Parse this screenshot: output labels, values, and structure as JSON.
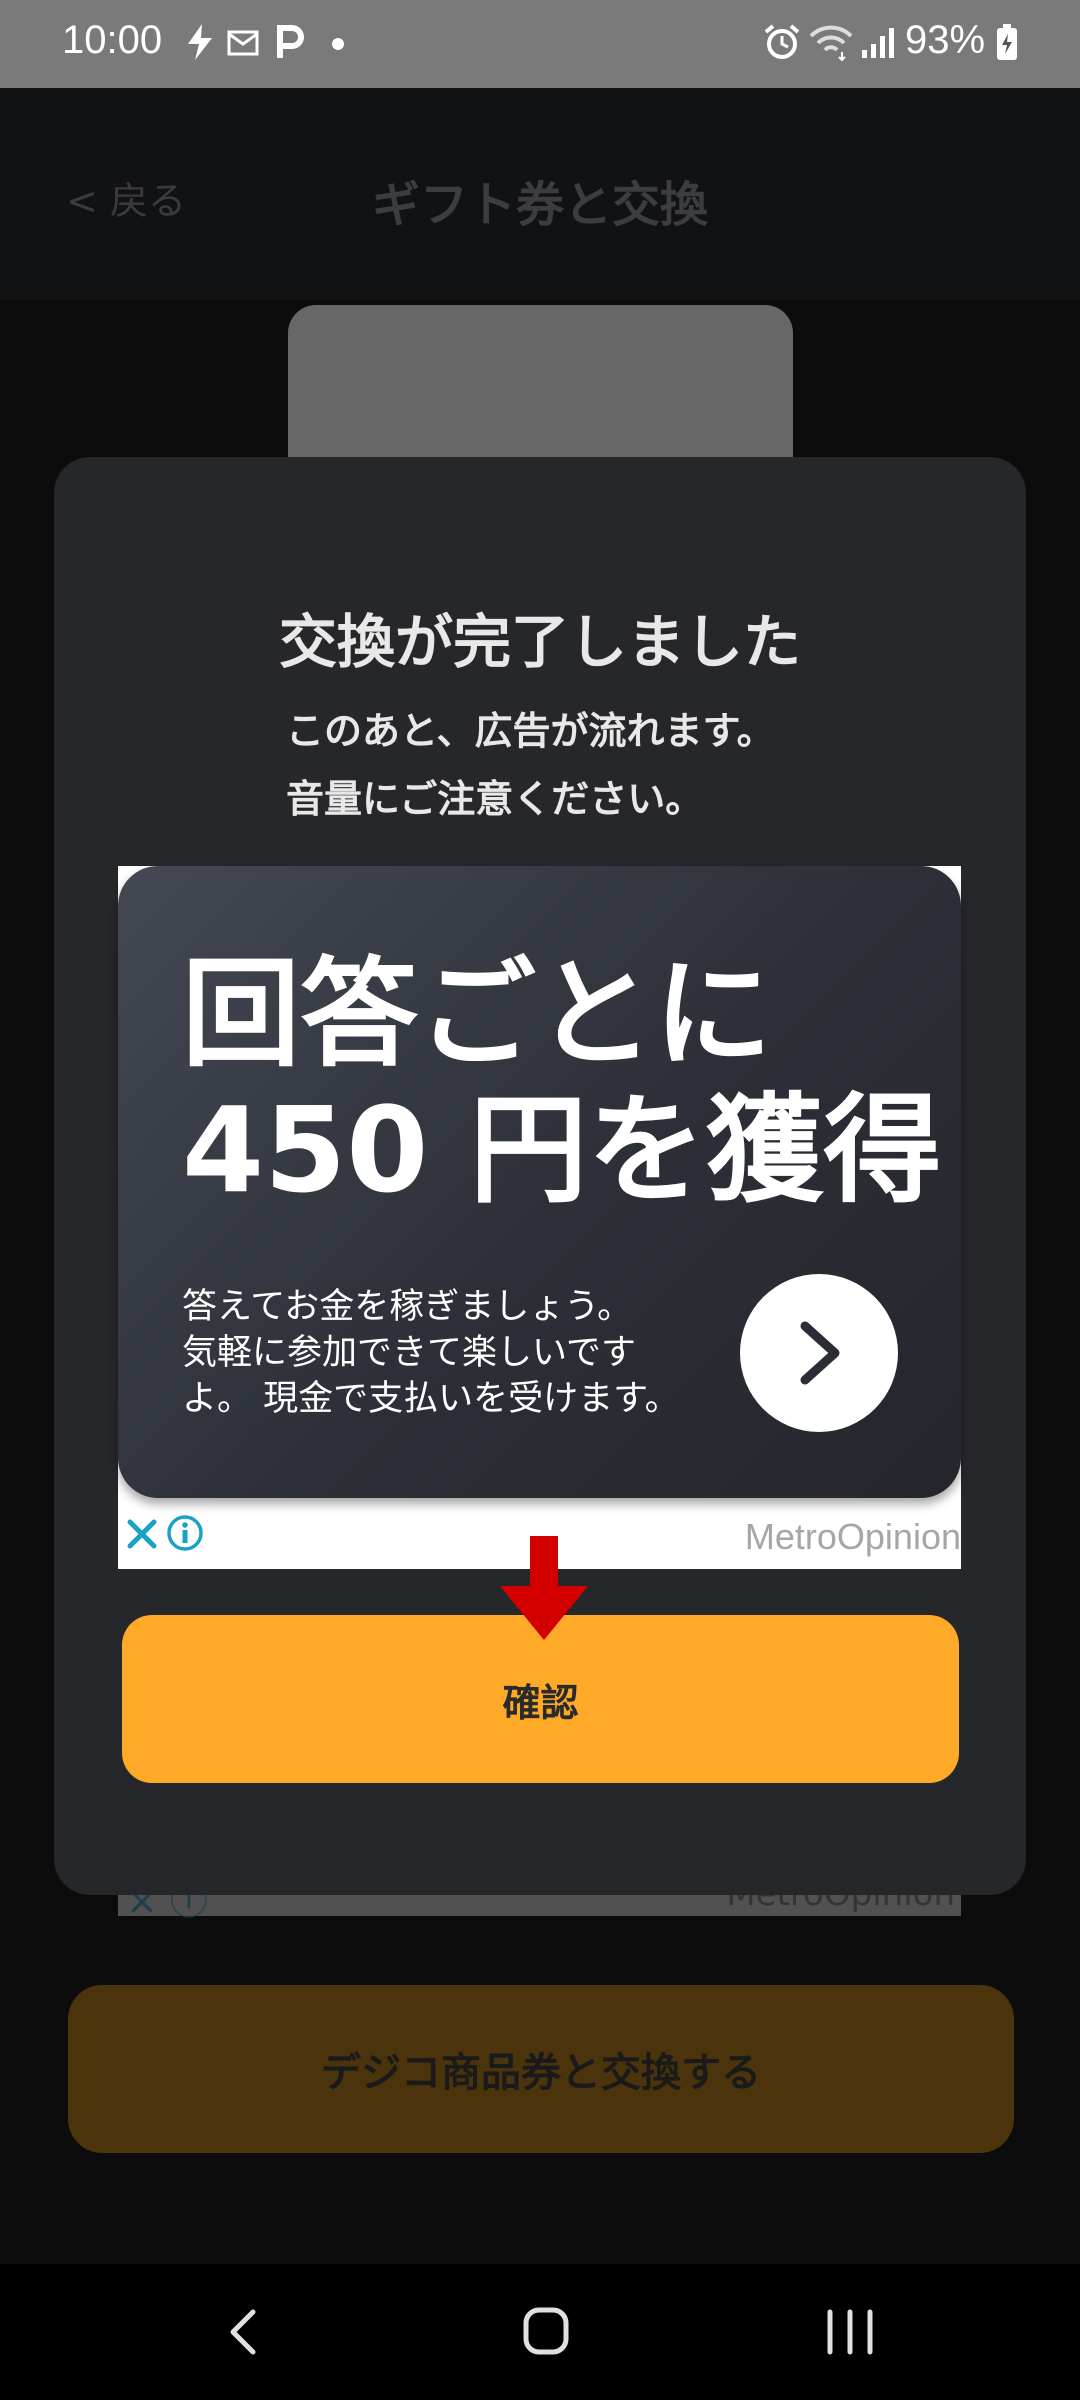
{
  "status_bar": {
    "time": "10:00",
    "battery_percent": "93%",
    "icons": [
      "bolt-icon",
      "app-notification-icon",
      "parking-icon",
      "dot-icon",
      "alarm-icon",
      "wifi-icon",
      "signal-icon",
      "battery-icon"
    ]
  },
  "background_page": {
    "back_label": "戻る",
    "title": "ギフト券と交換",
    "ad_brand": "MetroOpinion",
    "exchange_button_label": "デジコ商品券と交換する"
  },
  "dialog": {
    "title": "交換が完了しました",
    "message_line1": "このあと、広告が流れます。",
    "message_line2": "音量にご注意ください。",
    "confirm_label": "確認"
  },
  "ad": {
    "headline_line1": "回答ごとに",
    "headline_line2": "450 円を獲得",
    "body_line1": "答えてお金を稼ぎましょう。",
    "body_line2": "気軽に参加できて楽しいです",
    "body_line3": "よ。 現金で支払いを受けます。",
    "brand": "MetroOpinion"
  },
  "colors": {
    "accent": "#ffa928",
    "annotation_arrow": "#d40000",
    "dialog_bg": "#26272b",
    "ad_choices": "#1aa2c4"
  }
}
